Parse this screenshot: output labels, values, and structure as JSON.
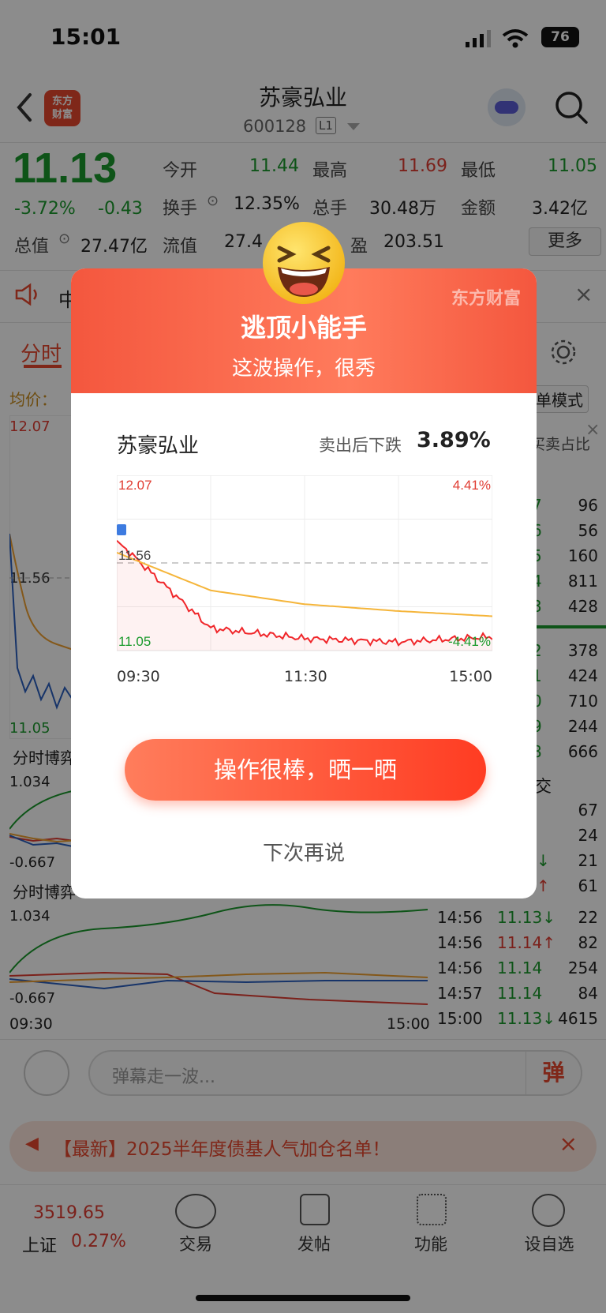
{
  "status_bar": {
    "time": "15:01",
    "battery": "76"
  },
  "header": {
    "logo_text_line1": "东方",
    "logo_text_line2": "财富",
    "title": "苏豪弘业",
    "code": "600128",
    "level": "L1"
  },
  "quote": {
    "price": "11.13",
    "change_pct": "-3.72%",
    "change": "-0.43",
    "fields": [
      {
        "label": "今开",
        "value": "11.44"
      },
      {
        "label": "最高",
        "value": "11.69"
      },
      {
        "label": "最低",
        "value": "11.05"
      },
      {
        "label": "换手",
        "value": "12.35%"
      },
      {
        "label": "总手",
        "value": "30.48万"
      },
      {
        "label": "金额",
        "value": "3.42亿"
      },
      {
        "label": "总值",
        "value": "27.47亿"
      },
      {
        "label": "流值",
        "value": "27.4"
      },
      {
        "label": "盈",
        "value": "203.51"
      }
    ],
    "more": "更多"
  },
  "notice": {
    "text": "中"
  },
  "tabs": {
    "active": "分时",
    "mode": "单模式"
  },
  "avg_label": "均价：",
  "chart_main": {
    "high": "12.07",
    "low": "11.05",
    "mid": "11.56",
    "sub1_title": "分时博弈",
    "sub2_title": "分时博弈",
    "sub_high": "1.034",
    "sub_low": "-0.667",
    "t_start": "09:30",
    "t_end": "15:00"
  },
  "right_panel": {
    "header": "买卖占比",
    "book": [
      {
        "a": "7",
        "b": "96"
      },
      {
        "a": "6",
        "b": "56"
      },
      {
        "a": "5",
        "b": "160"
      },
      {
        "a": "4",
        "b": "811"
      },
      {
        "a": "3",
        "b": "428"
      },
      {
        "a": "2",
        "b": "378"
      },
      {
        "a": "1",
        "b": "424"
      },
      {
        "a": "0",
        "b": "710"
      },
      {
        "a": "9",
        "b": "244"
      },
      {
        "a": "8",
        "b": "666"
      }
    ],
    "trades_header": "交",
    "trades_partial": [
      {
        "v": "67"
      },
      {
        "v": "24"
      },
      {
        "a": "↓",
        "v": "21"
      },
      {
        "a": "↑",
        "v": "61"
      }
    ],
    "trades": [
      {
        "time": "14:56",
        "price": "11.13↓",
        "vol": "22"
      },
      {
        "time": "14:56",
        "price": "11.14↑",
        "vol": "82"
      },
      {
        "time": "14:56",
        "price": "11.14",
        "vol": "254"
      },
      {
        "time": "14:57",
        "price": "11.14",
        "vol": "84"
      },
      {
        "time": "15:00",
        "price": "11.13↓",
        "vol": "4615"
      }
    ]
  },
  "danmu": {
    "placeholder": "弹幕走一波...",
    "btn": "弹"
  },
  "banner": {
    "text": "【最新】2025半年度债基人气加仓名单！"
  },
  "bottom_nav": {
    "index_value": "3519.65",
    "index_name": "上证",
    "index_change": "0.27%",
    "items": [
      {
        "label": "交易"
      },
      {
        "label": "发帖"
      },
      {
        "label": "功能"
      },
      {
        "label": "设自选"
      }
    ]
  },
  "modal": {
    "brand": "东方财富",
    "title": "逃顶小能手",
    "subtitle": "这波操作，很秀",
    "stock": "苏豪弘业",
    "drop_label": "卖出后下跌",
    "drop_value": "3.89%",
    "chart_high": "12.07",
    "chart_low": "11.05",
    "chart_mid": "11.56",
    "pct_high": "4.41%",
    "pct_low": "-4.41%",
    "times": [
      "09:30",
      "11:30",
      "15:00"
    ],
    "cta": "操作很棒，晒一晒",
    "later": "下次再说"
  },
  "chart_data": {
    "type": "line",
    "title": "",
    "x": [
      "09:30",
      "11:30",
      "15:00"
    ],
    "ylim": [
      11.05,
      12.07
    ],
    "series": [
      {
        "values": [
          11.69,
          11.18,
          11.12,
          11.1,
          11.13
        ]
      },
      {
        "values": [
          11.62,
          11.4,
          11.32,
          11.28,
          11.25
        ]
      }
    ]
  },
  "colors": {
    "accent_red": "#e03c32",
    "down_green": "#1a9a2c",
    "brand_orange": "#f4573e"
  }
}
